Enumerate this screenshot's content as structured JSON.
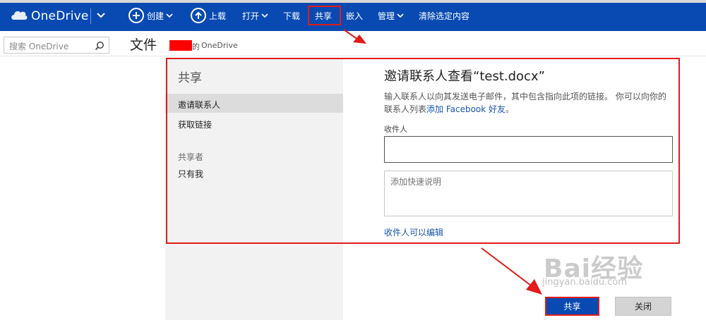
{
  "topbar": {
    "brand": "OneDrive",
    "commands": {
      "create": "创建",
      "upload": "上载",
      "open": "打开",
      "download": "下载",
      "share": "共享",
      "embed": "嵌入",
      "manage": "管理",
      "clear": "清除选定内容"
    }
  },
  "search": {
    "placeholder": "搜索 OneDrive"
  },
  "header": {
    "title": "文件",
    "owner_suffix": "的",
    "owner_location": "OneDrive"
  },
  "dialog": {
    "pane_title": "共享",
    "nav": {
      "invite": "邀请联系人",
      "link": "获取链接"
    },
    "shared_with_label": "共享者",
    "shared_with_value": "只有我",
    "title": "邀请联系人查看“test.docx”",
    "description_pre": "输入联系人以向其发送电子邮件，其中包含指向此项的链接。 你可以向你的联系人列表",
    "description_link": "添加 Facebook 好友",
    "description_post": "。",
    "recipients_label": "收件人",
    "note_placeholder": "添加快速说明",
    "permission_link": "收件人可以编辑",
    "share_button": "共享",
    "close_button": "关闭"
  },
  "watermark": {
    "brand": "Bai经验",
    "site": "jingyan.baidu.com"
  },
  "colors": {
    "brand_bar": "#094ab2",
    "highlight": "#e31b1b",
    "link": "#1a56b0"
  }
}
